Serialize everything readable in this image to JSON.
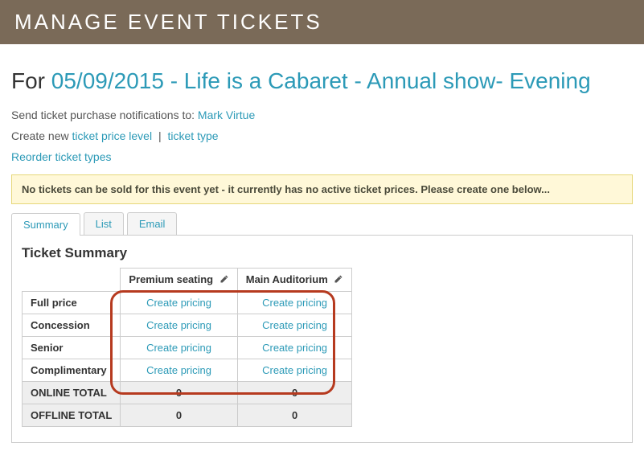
{
  "header": {
    "title": "MANAGE EVENT TICKETS"
  },
  "page": {
    "for_prefix": "For ",
    "event_title": "05/09/2015 - Life is a Cabaret - Annual show- Evening"
  },
  "notifications": {
    "label": "Send ticket purchase notifications to: ",
    "recipient": "Mark Virtue"
  },
  "create_new": {
    "label": "Create new ",
    "price_level": "ticket price level",
    "sep": " | ",
    "ticket_type": "ticket type"
  },
  "reorder_link": "Reorder ticket types",
  "alert": "No tickets can be sold for this event yet - it currently has no active ticket prices. Please create one below...",
  "tabs": {
    "summary": "Summary",
    "list": "List",
    "email": "Email"
  },
  "panel_title": "Ticket Summary",
  "columns": [
    "Premium seating",
    "Main Auditorium"
  ],
  "rows": [
    {
      "label": "Full price",
      "cells": [
        "Create pricing",
        "Create pricing"
      ]
    },
    {
      "label": "Concession",
      "cells": [
        "Create pricing",
        "Create pricing"
      ]
    },
    {
      "label": "Senior",
      "cells": [
        "Create pricing",
        "Create pricing"
      ]
    },
    {
      "label": "Complimentary",
      "cells": [
        "Create pricing",
        "Create pricing"
      ]
    }
  ],
  "totals": {
    "online": {
      "label": "ONLINE TOTAL",
      "values": [
        "0",
        "0"
      ]
    },
    "offline": {
      "label": "OFFLINE TOTAL",
      "values": [
        "0",
        "0"
      ]
    }
  }
}
